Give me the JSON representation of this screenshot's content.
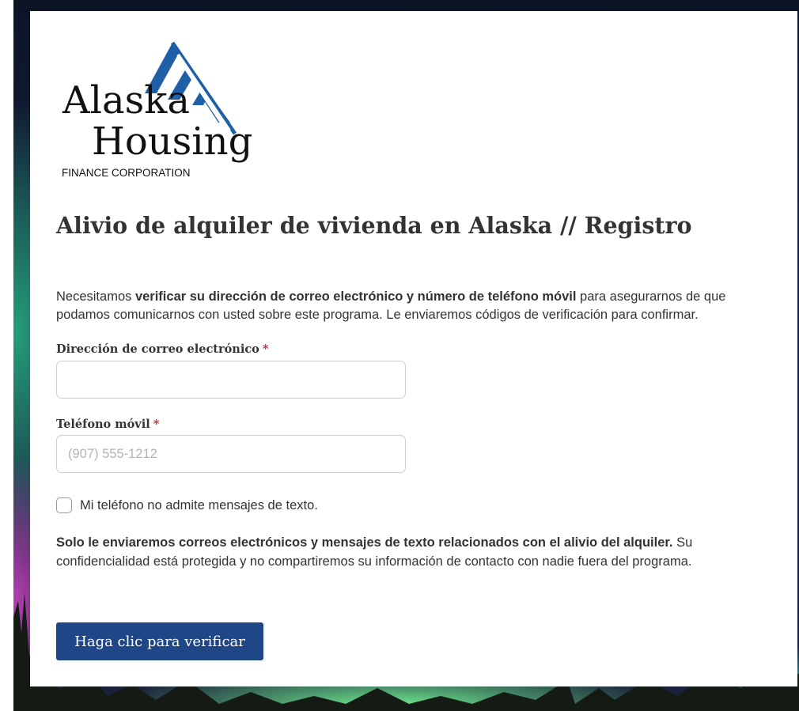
{
  "logo": {
    "line1": "Alaska",
    "line2": "Housing",
    "tagline": "FINANCE CORPORATION",
    "brand_color": "#1f5fa8"
  },
  "page_title": "Alivio de alquiler de vivienda en Alaska // Registro",
  "intro": {
    "lead": "Necesitamos ",
    "bold": "verificar su dirección de correo electrónico y número de teléfono móvil",
    "rest": " para asegurarnos de que podamos comunicarnos con usted sobre este programa. Le enviaremos códigos de verificación para confirmar."
  },
  "email": {
    "label": "Dirección de correo electrónico",
    "required_mark": "*",
    "value": "",
    "placeholder": ""
  },
  "phone": {
    "label": "Teléfono móvil",
    "required_mark": "*",
    "value": "",
    "placeholder": "(907) 555-1212"
  },
  "no_sms_checkbox": {
    "label": "Mi teléfono no admite mensajes de texto.",
    "checked": false
  },
  "notice": {
    "bold": "Solo le enviaremos correos electrónicos y mensajes de texto relacionados con el alivio del alquiler.",
    "rest": "  Su confidencialidad está protegida y no compartiremos su información de contacto con nadie fuera del programa."
  },
  "verify_button": {
    "label": "Haga clic para verificar",
    "color": "#1f4788"
  },
  "colors": {
    "required": "#c0272d",
    "text": "#333333"
  }
}
